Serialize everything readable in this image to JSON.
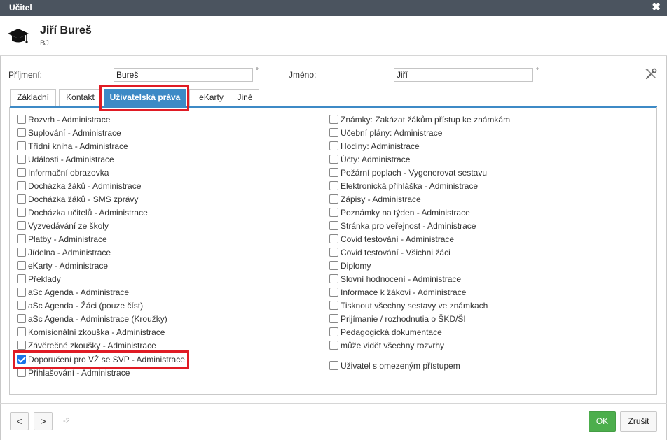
{
  "window": {
    "title": "Učitel",
    "close_icon": "close-icon"
  },
  "user": {
    "name": "Jiří Bureš",
    "abbr": "BJ",
    "icon": "graduation-cap-icon"
  },
  "form": {
    "surname_label": "Příjmení:",
    "surname_value": "Bureš",
    "firstname_label": "Jméno:",
    "firstname_value": "Jiří",
    "degree_mark": "°",
    "tools_icon": "tools-icon"
  },
  "tabs": [
    {
      "label": "Základní",
      "active": false
    },
    {
      "label": "Kontakt",
      "active": false
    },
    {
      "label": "Uživatelská práva",
      "active": true
    },
    {
      "label": "eKarty",
      "active": false
    },
    {
      "label": "Jiné",
      "active": false
    }
  ],
  "permissions_left": [
    {
      "label": "Rozvrh - Administrace",
      "checked": false
    },
    {
      "label": "Suplování - Administrace",
      "checked": false
    },
    {
      "label": "Třídní kniha - Administrace",
      "checked": false
    },
    {
      "label": "Události - Administrace",
      "checked": false
    },
    {
      "label": "Informační obrazovka",
      "checked": false
    },
    {
      "label": "Docházka žáků - Administrace",
      "checked": false
    },
    {
      "label": "Docházka žáků - SMS zprávy",
      "checked": false
    },
    {
      "label": "Docházka učitelů - Administrace",
      "checked": false
    },
    {
      "label": "Vyzvedávání ze školy",
      "checked": false
    },
    {
      "label": "Platby - Administrace",
      "checked": false
    },
    {
      "label": "Jídelna - Administrace",
      "checked": false
    },
    {
      "label": "eKarty - Administrace",
      "checked": false
    },
    {
      "label": "Překlady",
      "checked": false
    },
    {
      "label": "aSc Agenda - Administrace",
      "checked": false
    },
    {
      "label": "aSc Agenda - Žáci (pouze číst)",
      "checked": false
    },
    {
      "label": "aSc Agenda - Administrace (Kroužky)",
      "checked": false
    },
    {
      "label": "Komisionální zkouška - Administrace",
      "checked": false
    },
    {
      "label": "Závěrečné zkoušky - Administrace",
      "checked": false
    },
    {
      "label": "Doporučení pro VŽ se SVP - Administrace",
      "checked": true
    },
    {
      "label": "Přihlašování - Administrace",
      "checked": false
    }
  ],
  "permissions_right": [
    {
      "label": "Známky: Zakázat žákům přístup ke známkám",
      "checked": false
    },
    {
      "label": "Učební plány: Administrace",
      "checked": false
    },
    {
      "label": "Hodiny: Administrace",
      "checked": false
    },
    {
      "label": "Účty: Administrace",
      "checked": false
    },
    {
      "label": "Požární poplach - Vygenerovat sestavu",
      "checked": false
    },
    {
      "label": "Elektronická přihláška - Administrace",
      "checked": false
    },
    {
      "label": "Zápisy - Administrace",
      "checked": false
    },
    {
      "label": "Poznámky na týden - Administrace",
      "checked": false
    },
    {
      "label": "Stránka pro veřejnost - Administrace",
      "checked": false
    },
    {
      "label": "Covid testování - Administrace",
      "checked": false
    },
    {
      "label": "Covid testování - Všichni žáci",
      "checked": false
    },
    {
      "label": "Diplomy",
      "checked": false
    },
    {
      "label": "Slovní hodnocení - Administrace",
      "checked": false
    },
    {
      "label": "Informace k žákovi - Administrace",
      "checked": false
    },
    {
      "label": "Tisknout všechny sestavy ve známkach",
      "checked": false
    },
    {
      "label": "Prijímanie / rozhodnutia o ŠKD/ŠI",
      "checked": false
    },
    {
      "label": "Pedagogická dokumentace",
      "checked": false
    },
    {
      "label": "může vidět všechny rozvrhy",
      "checked": false
    },
    {
      "label": "Uživatel s omezeným přístupem",
      "checked": false
    }
  ],
  "footer": {
    "prev_label": "<",
    "next_label": ">",
    "counter": "-2",
    "ok_label": "OK",
    "cancel_label": "Zrušit"
  },
  "colors": {
    "accent": "#3d8ac6",
    "highlight": "#e01b24",
    "ok": "#4cae4c",
    "titlebar": "#4b545f"
  }
}
